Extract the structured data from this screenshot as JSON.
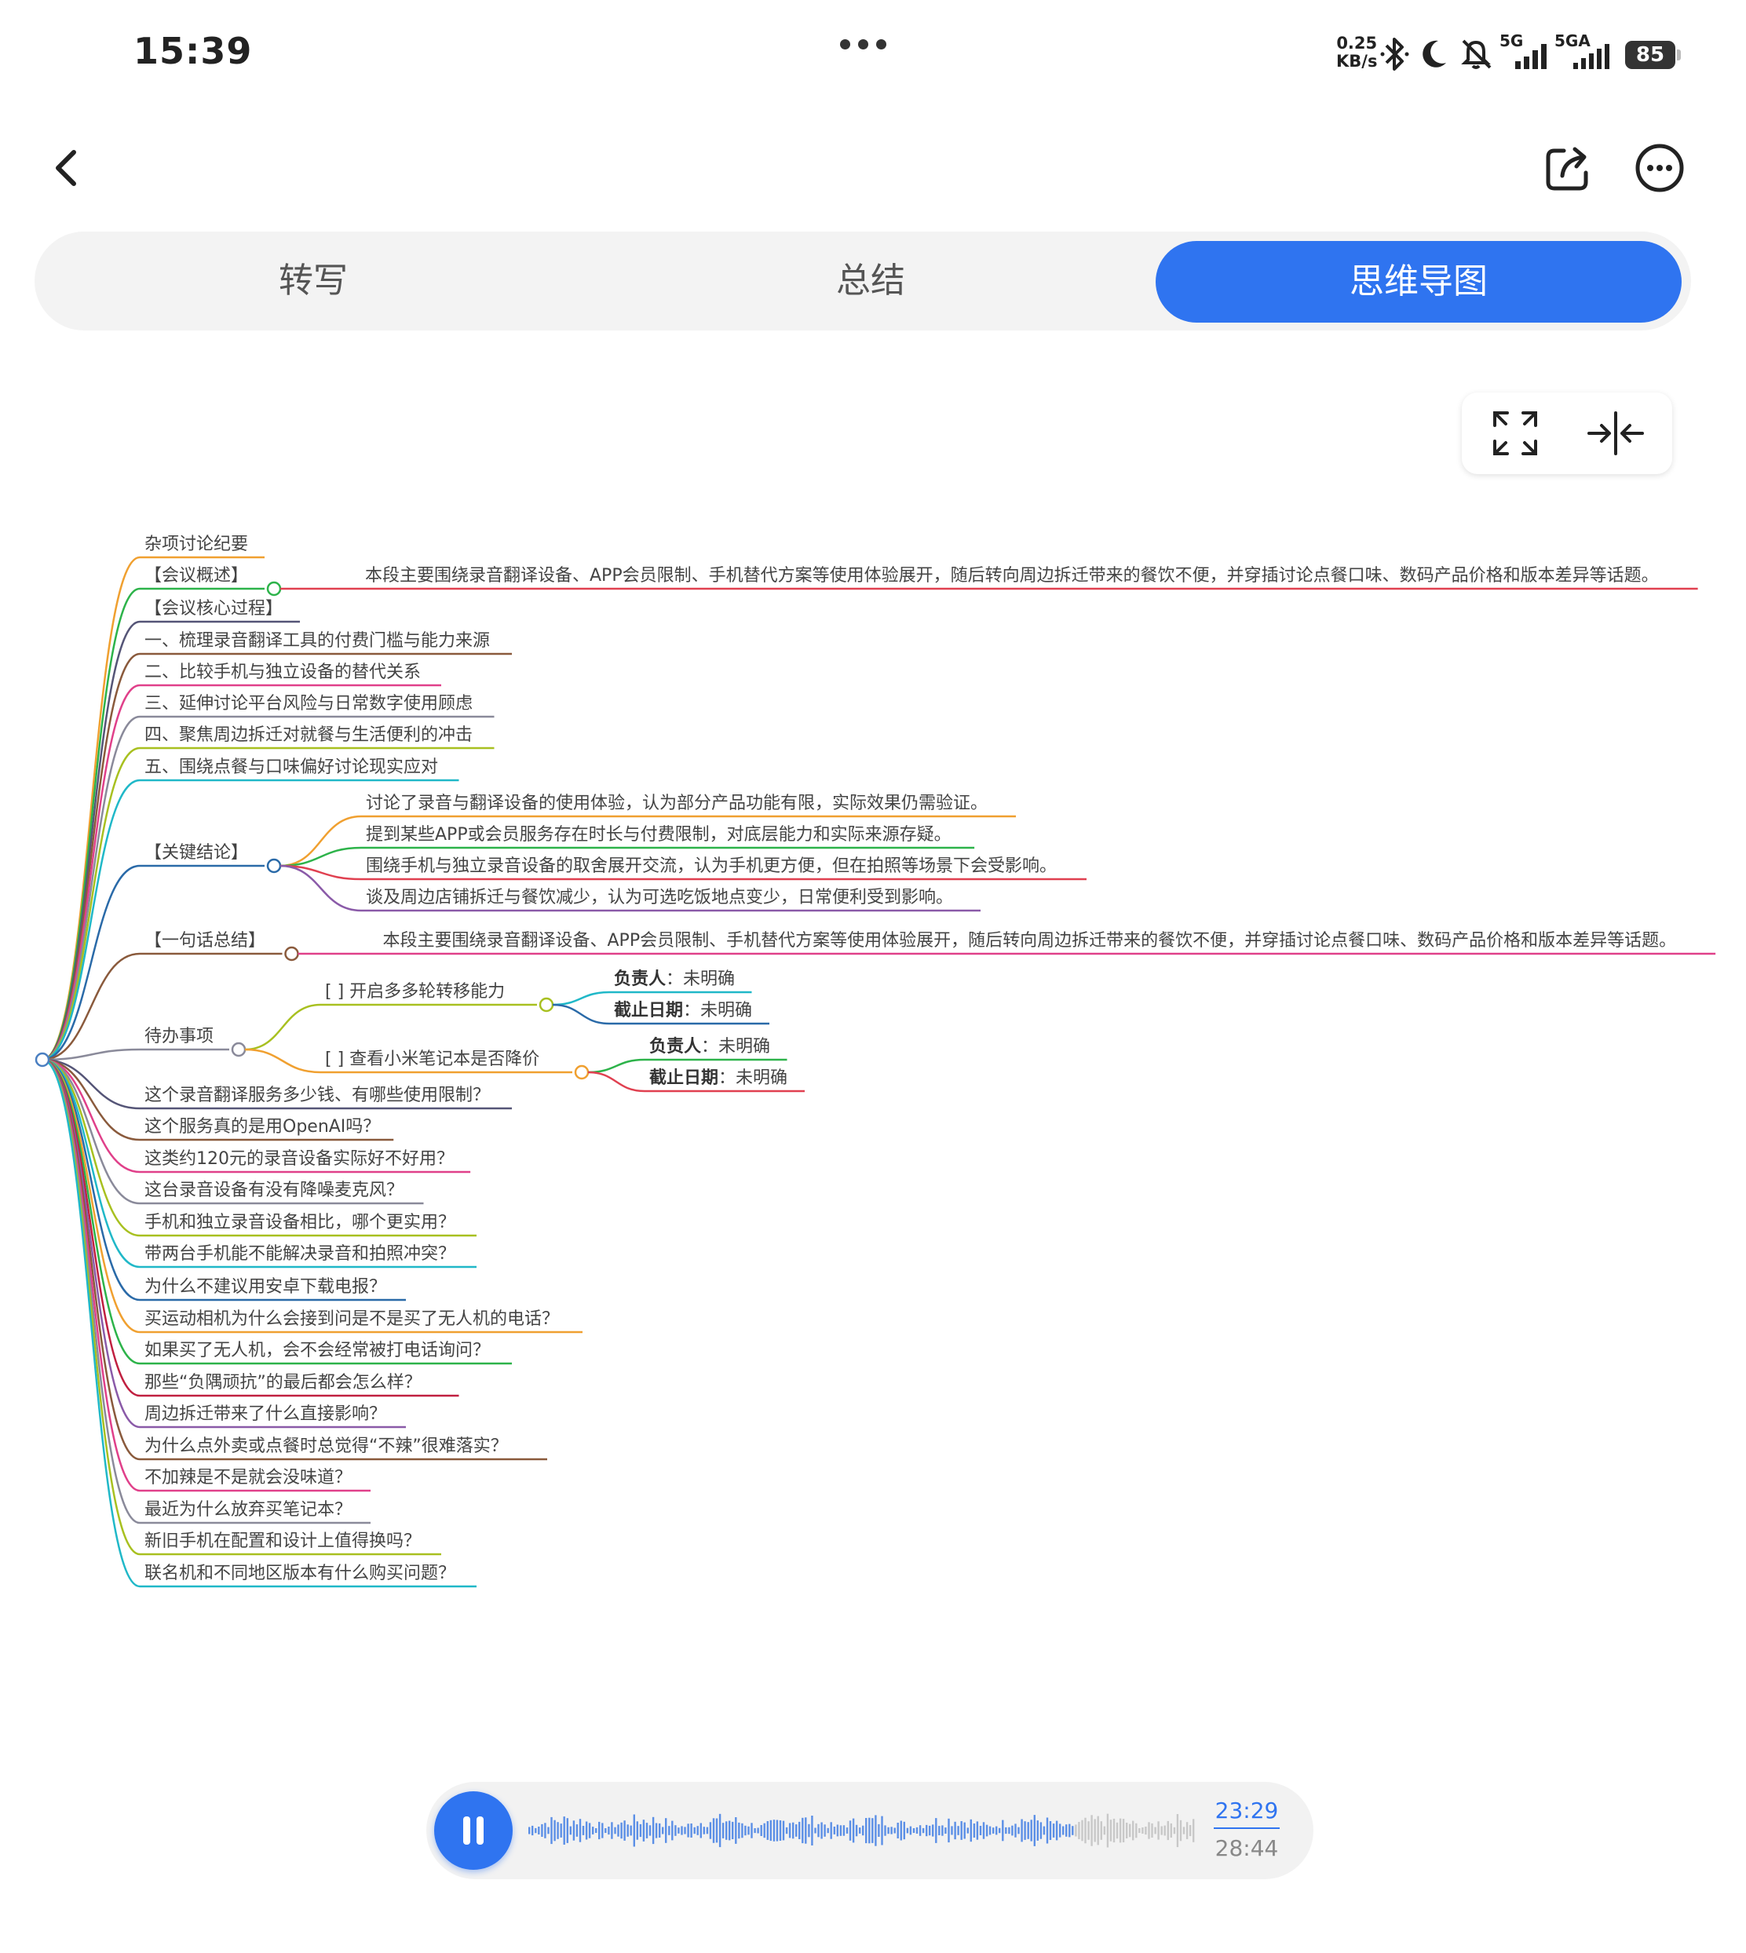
{
  "status_bar": {
    "time": "15:39",
    "net_speed_value": "0.25",
    "net_speed_unit": "KB/s",
    "signal1": "5G",
    "signal2": "5GA",
    "battery": "85",
    "icons": [
      "bluetooth-icon",
      "moon-icon",
      "mute-icon",
      "signal-icon",
      "battery-icon"
    ]
  },
  "header": {
    "icons": [
      "back-icon",
      "share-icon",
      "more-icon"
    ]
  },
  "tabs": [
    {
      "label": "转写",
      "active": false
    },
    {
      "label": "总结",
      "active": false
    },
    {
      "label": "思维导图",
      "active": true
    }
  ],
  "mindmap": {
    "root_color": "#4a7fc1",
    "nodes": [
      {
        "label": "杂项讨论纪要",
        "color": "#f0a030"
      },
      {
        "label": "【会议概述】",
        "color": "#2db34a",
        "children": [
          {
            "label": "本段主要围绕录音翻译设备、APP会员限制、手机替代方案等使用体验展开，随后转向周边拆迁带来的餐饮不便，并穿插讨论点餐口味、数码产品价格和版本差异等话题。",
            "color": "#e04050"
          }
        ]
      },
      {
        "label": "【会议核心过程】",
        "color": "#555577"
      },
      {
        "label": "一、梳理录音翻译工具的付费门槛与能力来源",
        "color": "#8a5a3c"
      },
      {
        "label": "二、比较手机与独立设备的替代关系",
        "color": "#e0408a"
      },
      {
        "label": "三、延伸讨论平台风险与日常数字使用顾虑",
        "color": "#8a8a9a"
      },
      {
        "label": "四、聚焦周边拆迁对就餐与生活便利的冲击",
        "color": "#a8c020"
      },
      {
        "label": "五、围绕点餐与口味偏好讨论现实应对",
        "color": "#20b8c8"
      },
      {
        "label": "【关键结论】",
        "color": "#2a6aa8",
        "children": [
          {
            "label": "讨论了录音与翻译设备的使用体验，认为部分产品功能有限，实际效果仍需验证。",
            "color": "#f0a030"
          },
          {
            "label": "提到某些APP或会员服务存在时长与付费限制，对底层能力和实际来源存疑。",
            "color": "#2db34a"
          },
          {
            "label": "围绕手机与独立录音设备的取舍展开交流，认为手机更方便，但在拍照等场景下会受影响。",
            "color": "#e04050"
          },
          {
            "label": "谈及周边店铺拆迁与餐饮减少，认为可选吃饭地点变少，日常便利受到影响。",
            "color": "#8a5aa8"
          }
        ]
      },
      {
        "label": "【一句话总结】",
        "color": "#8a5a3c",
        "children": [
          {
            "label": "本段主要围绕录音翻译设备、APP会员限制、手机替代方案等使用体验展开，随后转向周边拆迁带来的餐饮不便，并穿插讨论点餐口味、数码产品价格和版本差异等话题。",
            "color": "#e0408a"
          }
        ]
      },
      {
        "label": "待办事项",
        "color": "#8a8a9a",
        "children": [
          {
            "label": "[ ] 开启多多轮转移能力",
            "color": "#a8c020",
            "children": [
              {
                "bold": "负责人",
                "rest": "：未明确",
                "color": "#20b8c8"
              },
              {
                "bold": "截止日期",
                "rest": "：未明确",
                "color": "#2a6aa8"
              }
            ]
          },
          {
            "label": "[ ] 查看小米笔记本是否降价",
            "color": "#f0a030",
            "children": [
              {
                "bold": "负责人",
                "rest": "：未明确",
                "color": "#2db34a"
              },
              {
                "bold": "截止日期",
                "rest": "：未明确",
                "color": "#e04050"
              }
            ]
          }
        ]
      },
      {
        "label": "这个录音翻译服务多少钱、有哪些使用限制？",
        "color": "#555577"
      },
      {
        "label": "这个服务真的是用OpenAI吗？",
        "color": "#8a5a3c"
      },
      {
        "label": "这类约120元的录音设备实际好不好用？",
        "color": "#e0408a"
      },
      {
        "label": "这台录音设备有没有降噪麦克风？",
        "color": "#8a8a9a"
      },
      {
        "label": "手机和独立录音设备相比，哪个更实用？",
        "color": "#a8c020"
      },
      {
        "label": "带两台手机能不能解决录音和拍照冲突？",
        "color": "#20b8c8"
      },
      {
        "label": "为什么不建议用安卓下载电报？",
        "color": "#2a6aa8"
      },
      {
        "label": "买运动相机为什么会接到问是不是买了无人机的电话？",
        "color": "#f0a030"
      },
      {
        "label": "如果买了无人机，会不会经常被打电话询问？",
        "color": "#2db34a"
      },
      {
        "label": "那些“负隅顽抗”的最后都会怎么样？",
        "color": "#c02040"
      },
      {
        "label": "周边拆迁带来了什么直接影响？",
        "color": "#8a5aa8"
      },
      {
        "label": "为什么点外卖或点餐时总觉得“不辣”很难落实？",
        "color": "#8a5a3c"
      },
      {
        "label": "不加辣是不是就会没味道？",
        "color": "#e0408a"
      },
      {
        "label": "最近为什么放弃买笔记本？",
        "color": "#8a8a9a"
      },
      {
        "label": "新旧手机在配置和设计上值得换吗？",
        "color": "#a8c020"
      },
      {
        "label": "联名机和不同地区版本有什么购买问题？",
        "color": "#20b8c8"
      }
    ]
  },
  "player": {
    "state": "playing",
    "current_time": "23:29",
    "total_time": "28:44",
    "progress": 0.817,
    "played_color": "#5b8fe6",
    "unplayed_color": "#c8c8c8"
  }
}
